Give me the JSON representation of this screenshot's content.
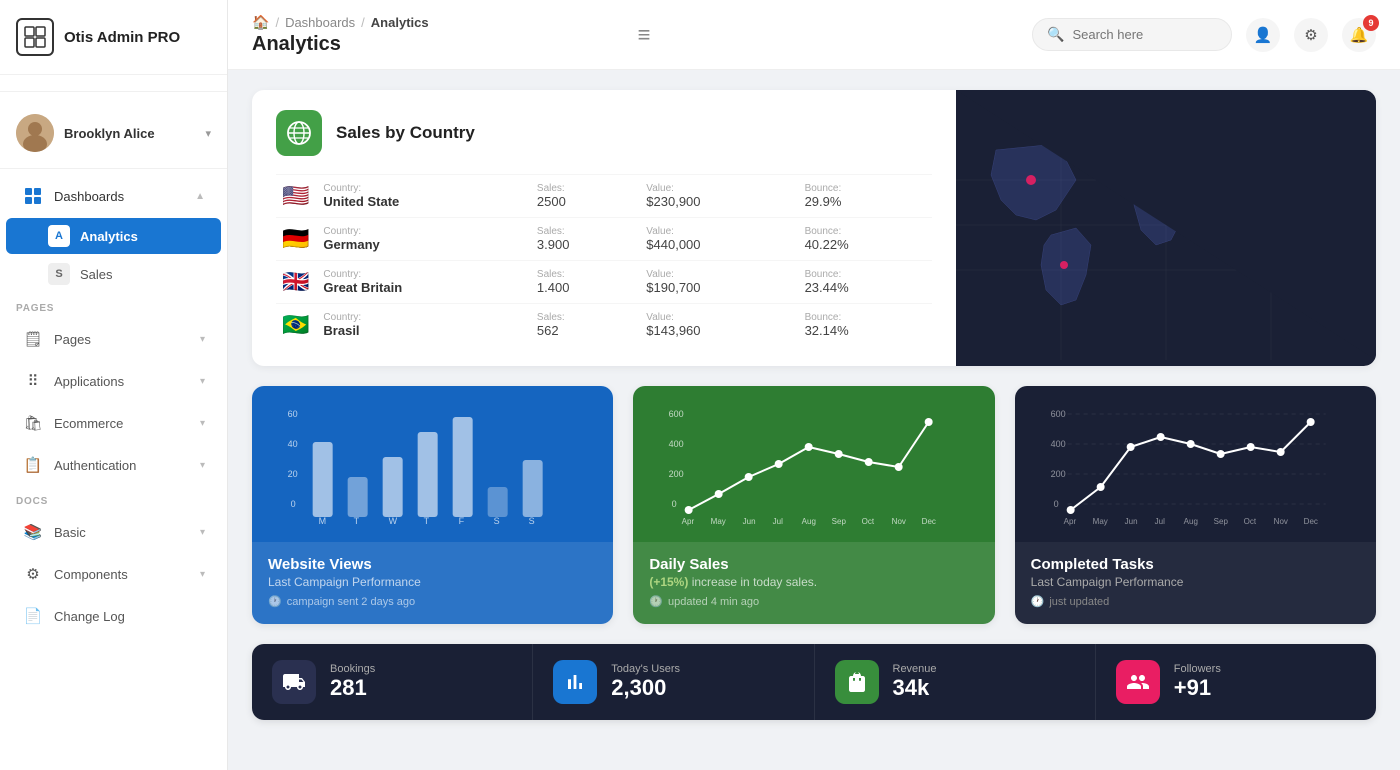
{
  "app": {
    "name": "Otis Admin PRO"
  },
  "user": {
    "name": "Brooklyn Alice"
  },
  "header": {
    "breadcrumb_home": "🏠",
    "breadcrumb_dashboards": "Dashboards",
    "breadcrumb_analytics": "Analytics",
    "page_title": "Analytics",
    "menu_icon": "≡",
    "search_placeholder": "Search here",
    "notification_count": "9"
  },
  "sidebar": {
    "section_pages": "PAGES",
    "section_docs": "DOCS",
    "nav_items": [
      {
        "id": "dashboards",
        "label": "Dashboards",
        "icon": "⊞",
        "active": false,
        "open": true
      },
      {
        "id": "analytics",
        "label": "Analytics",
        "icon": "A",
        "active": true,
        "sub": true
      },
      {
        "id": "sales",
        "label": "Sales",
        "icon": "S",
        "active": false,
        "sub": true
      },
      {
        "id": "pages",
        "label": "Pages",
        "icon": "🗒",
        "active": false
      },
      {
        "id": "applications",
        "label": "Applications",
        "icon": "⠿",
        "active": false
      },
      {
        "id": "ecommerce",
        "label": "Ecommerce",
        "icon": "🛍",
        "active": false
      },
      {
        "id": "authentication",
        "label": "Authentication",
        "icon": "📋",
        "active": false
      },
      {
        "id": "basic",
        "label": "Basic",
        "icon": "📚",
        "active": false
      },
      {
        "id": "components",
        "label": "Components",
        "icon": "⚙",
        "active": false
      },
      {
        "id": "changelog",
        "label": "Change Log",
        "icon": "📄",
        "active": false
      }
    ]
  },
  "sales_by_country": {
    "title": "Sales by Country",
    "countries": [
      {
        "flag": "🇺🇸",
        "country_label": "Country:",
        "country": "United State",
        "sales_label": "Sales:",
        "sales": "2500",
        "value_label": "Value:",
        "value": "$230,900",
        "bounce_label": "Bounce:",
        "bounce": "29.9%"
      },
      {
        "flag": "🇩🇪",
        "country_label": "Country:",
        "country": "Germany",
        "sales_label": "Sales:",
        "sales": "3.900",
        "value_label": "Value:",
        "value": "$440,000",
        "bounce_label": "Bounce:",
        "bounce": "40.22%"
      },
      {
        "flag": "🇬🇧",
        "country_label": "Country:",
        "country": "Great Britain",
        "sales_label": "Sales:",
        "sales": "1.400",
        "value_label": "Value:",
        "value": "$190,700",
        "bounce_label": "Bounce:",
        "bounce": "23.44%"
      },
      {
        "flag": "🇧🇷",
        "country_label": "Country:",
        "country": "Brasil",
        "sales_label": "Sales:",
        "sales": "562",
        "value_label": "Value:",
        "value": "$143,960",
        "bounce_label": "Bounce:",
        "bounce": "32.14%"
      }
    ]
  },
  "chart_website_views": {
    "title": "Website Views",
    "subtitle": "Last Campaign Performance",
    "meta": "campaign sent 2 days ago",
    "y_labels": [
      "60",
      "40",
      "20",
      "0"
    ],
    "x_labels": [
      "M",
      "T",
      "W",
      "T",
      "F",
      "S",
      "S"
    ],
    "bars": [
      45,
      20,
      38,
      50,
      60,
      12,
      35
    ]
  },
  "chart_daily_sales": {
    "title": "Daily Sales",
    "highlight": "(+15%)",
    "subtitle": "increase in today sales.",
    "meta": "updated 4 min ago",
    "y_labels": [
      "600",
      "400",
      "200",
      "0"
    ],
    "x_labels": [
      "Apr",
      "May",
      "Jun",
      "Jul",
      "Aug",
      "Sep",
      "Oct",
      "Nov",
      "Dec"
    ],
    "points": [
      10,
      80,
      200,
      280,
      420,
      340,
      250,
      200,
      490
    ]
  },
  "chart_completed_tasks": {
    "title": "Completed Tasks",
    "subtitle": "Last Campaign Performance",
    "meta": "just updated",
    "y_labels": [
      "600",
      "400",
      "200",
      "0"
    ],
    "x_labels": [
      "Apr",
      "May",
      "Jun",
      "Jul",
      "Aug",
      "Sep",
      "Oct",
      "Nov",
      "Dec"
    ],
    "points": [
      20,
      100,
      320,
      400,
      340,
      280,
      350,
      300,
      490
    ]
  },
  "stats": [
    {
      "id": "bookings",
      "icon": "🛋",
      "icon_style": "dark",
      "label": "Bookings",
      "value": "281"
    },
    {
      "id": "today_users",
      "icon": "📊",
      "icon_style": "blue",
      "label": "Today's Users",
      "value": "2,300"
    },
    {
      "id": "revenue",
      "icon": "🏪",
      "icon_style": "green",
      "label": "Revenue",
      "value": "34k"
    },
    {
      "id": "followers",
      "icon": "👤",
      "icon_style": "pink",
      "label": "Followers",
      "value": "+91"
    }
  ]
}
